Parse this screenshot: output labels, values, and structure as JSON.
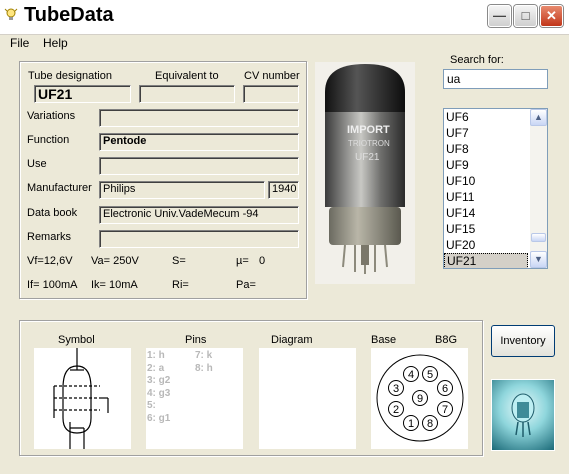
{
  "window": {
    "title": "TubeData"
  },
  "menu": {
    "file": "File",
    "help": "Help"
  },
  "header_labels": {
    "tube_designation": "Tube designation",
    "equivalent_to": "Equivalent to",
    "cv_number": "CV number"
  },
  "tube": {
    "designation": "UF21",
    "equivalent": "",
    "cv_number": "",
    "variations": "",
    "function": "Pentode",
    "use": "",
    "manufacturer": "Philips",
    "year": "1940",
    "data_book": "Electronic Univ.VadeMecum -94",
    "remarks": ""
  },
  "field_labels": {
    "variations": "Variations",
    "function": "Function",
    "use": "Use",
    "manufacturer": "Manufacturer",
    "data_book": "Data book",
    "remarks": "Remarks"
  },
  "params": {
    "vf": "Vf=12,6V",
    "va": "Va= 250V",
    "s": "S=",
    "mu": "µ=",
    "mu_val": "0",
    "if": "If= 100mA",
    "ik": "Ik=  10mA",
    "ri": "Ri=",
    "pa": "Pa="
  },
  "photo_text": {
    "line1": "IMPORT",
    "line2": "TRIOTRON",
    "line3": "UF21"
  },
  "search": {
    "label": "Search for:",
    "value": "ua"
  },
  "list": {
    "items": [
      "UF6",
      "UF7",
      "UF8",
      "UF9",
      "UF10",
      "UF11",
      "UF14",
      "UF15",
      "UF20",
      "UF21"
    ],
    "selected": "UF21"
  },
  "bottom": {
    "symbol": "Symbol",
    "pins": "Pins",
    "diagram": "Diagram",
    "base": "Base",
    "base_type": "B8G",
    "pins_col1": "1: h\n2: a\n3: g2\n4: g3\n5:\n6: g1",
    "pins_col2": "7: k\n8: h"
  },
  "base_pins": [
    "3",
    "4",
    "5",
    "6",
    "2",
    "9",
    "7",
    "1",
    "8"
  ],
  "inventory_label": "Inventory",
  "colors": {
    "panel_bg": "#ece9d8",
    "close_button": "#c1361a",
    "selection": "#d4d0c8"
  }
}
